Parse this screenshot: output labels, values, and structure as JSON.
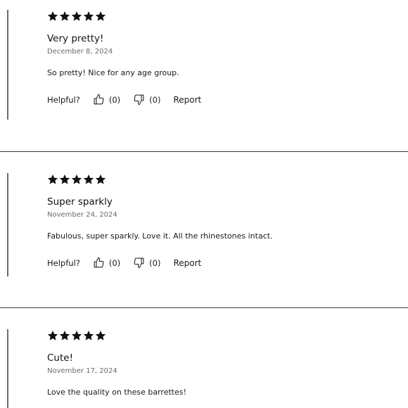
{
  "reviews": [
    {
      "rating": 5,
      "title": "Very pretty!",
      "date": "December 8, 2024",
      "body": "So pretty! Nice for any age group.",
      "helpful_label": "Helpful?",
      "helpful_yes": "(0)",
      "helpful_no": "(0)",
      "report_label": "Report"
    },
    {
      "rating": 5,
      "title": "Super sparkly",
      "date": "November 24, 2024",
      "body": "Fabulous, super sparkly. Love it. All the rhinestones intact.",
      "helpful_label": "Helpful?",
      "helpful_yes": "(0)",
      "helpful_no": "(0)",
      "report_label": "Report"
    },
    {
      "rating": 5,
      "title": "Cute!",
      "date": "November 17, 2024",
      "body": "Love the quality on these barrettes!"
    }
  ],
  "colors": {
    "star": "#111111",
    "divider": "#3a3a3a",
    "accent_bar": "#6b6b6b",
    "date_text": "#6b6b6b"
  }
}
